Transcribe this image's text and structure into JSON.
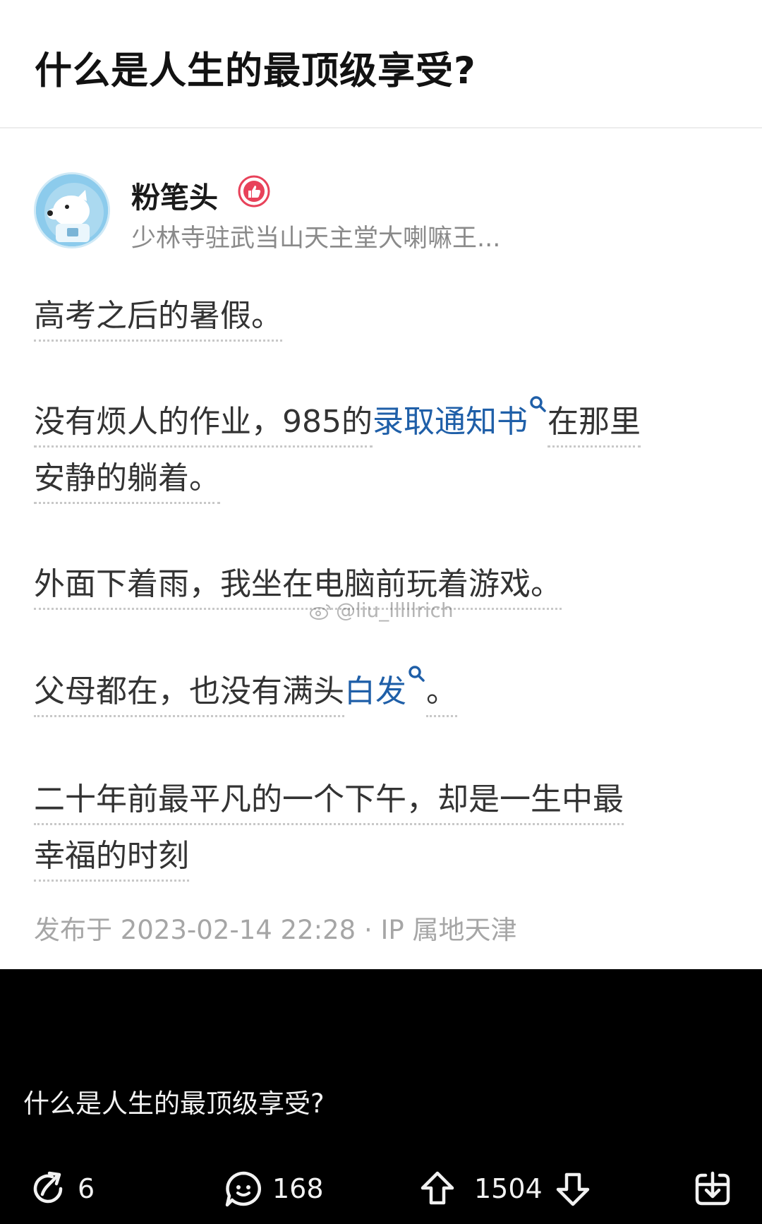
{
  "question": {
    "title": "什么是人生的最顶级享受?"
  },
  "answer": {
    "author": {
      "name": "粉笔头",
      "bio": "少林寺驻武当山天主堂大喇嘛王..."
    },
    "paragraphs": [
      [
        "高考之后的暑假。"
      ],
      [
        "没有烦人的作业，985的",
        "录取通知书",
        "在那里",
        "安静的躺着。"
      ],
      [
        "外面下着雨，我坐在电脑前玩着游戏。"
      ],
      [
        "父母都在，也没有满头",
        "白发",
        "。"
      ],
      [
        "二十年前最平凡的一个下午，却是一生中最",
        "幸福的时刻"
      ]
    ],
    "meta": "发布于 2023-02-14 22:28 · IP 属地天津",
    "watermark": "@liu_lllllrich"
  },
  "feed": {
    "caption": "什么是人生的最顶级享受?",
    "actions": {
      "share_count": "6",
      "comment_count": "168",
      "upvote_count": "1504"
    }
  },
  "colors": {
    "link": "#1f5fa8",
    "body_text": "#333333",
    "meta_text": "#a6a6a6",
    "badge": "#e8425a",
    "feed_background": "#000000"
  },
  "icons": {
    "badge": "thumbs-up-badge-icon",
    "search": "search-icon",
    "share": "share-icon",
    "comment": "comment-icon",
    "upvote": "upvote-arrow-icon",
    "downvote": "downvote-arrow-icon",
    "save": "download-icon"
  }
}
